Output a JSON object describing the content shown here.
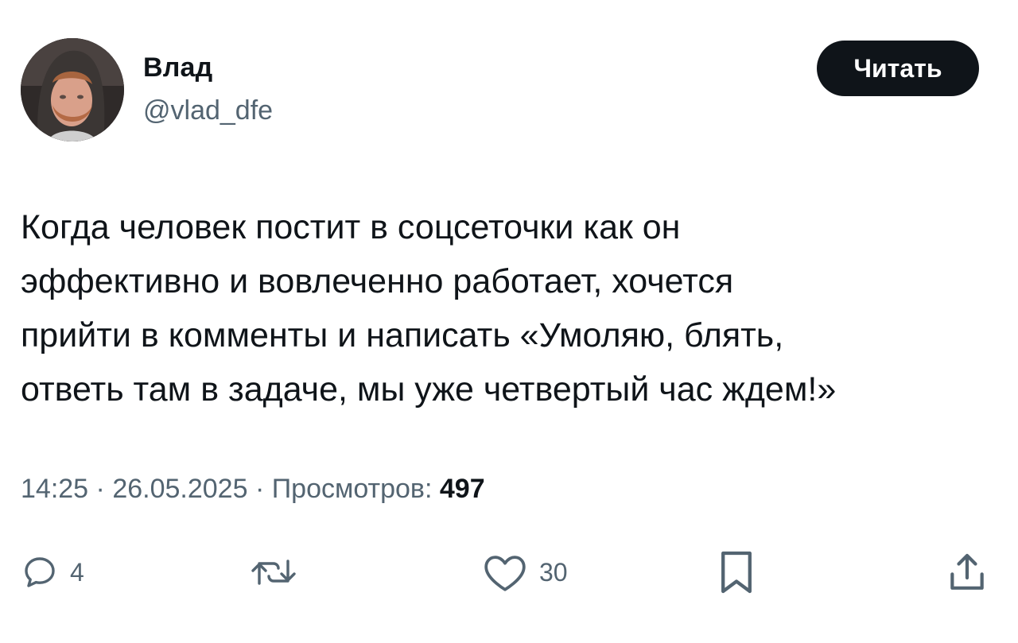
{
  "author": {
    "name": "Влад",
    "handle": "@vlad_dfe"
  },
  "header": {
    "read_button_label": "Читать"
  },
  "tweet": {
    "lines": [
      "Когда человек постит в соцсеточки как он",
      "эффективно и вовлеченно работает, хочется",
      "прийти в комменты и написать «Умоляю, блять,",
      "ответь там в задаче, мы уже четвертый час ждем!»"
    ]
  },
  "meta": {
    "time": "14:25",
    "date": "26.05.2025",
    "views_label": "Просмотров:",
    "views_count": "497",
    "separator": "·"
  },
  "actions": {
    "reply_icon": "speech-bubble-icon",
    "reply_count": "4",
    "retweet_icon": "retweet-icon",
    "like_icon": "heart-icon",
    "like_count": "30",
    "bookmark_icon": "bookmark-icon",
    "share_icon": "share-icon"
  },
  "colors": {
    "text_primary": "#0f1419",
    "text_secondary": "#536471",
    "button_bg": "#0f1419",
    "button_text": "#ffffff",
    "background": "#ffffff"
  }
}
